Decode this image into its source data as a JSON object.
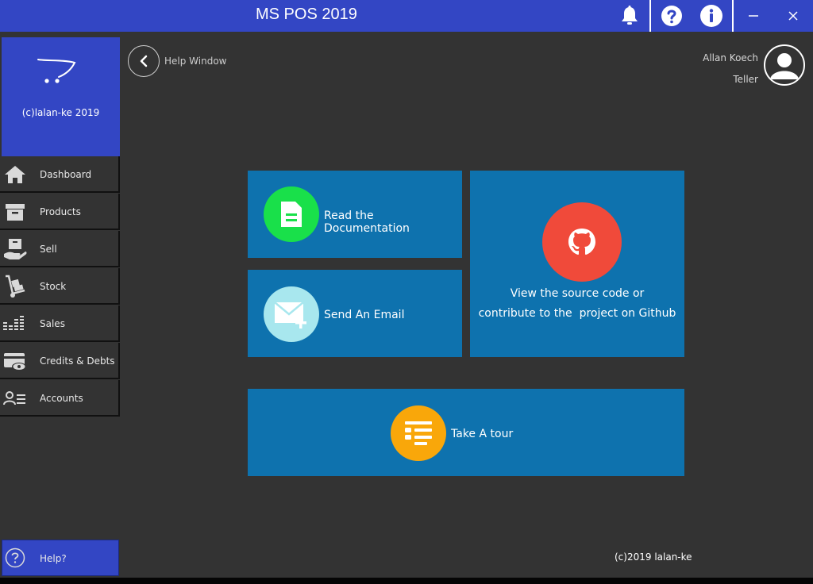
{
  "window": {
    "title": "MS POS 2019"
  },
  "colors": {
    "titlebar": "#3346c4",
    "tile": "#0e72ae",
    "docs_circle": "#19e04a",
    "email_circle": "#a8e7ee",
    "github_circle": "#f04a3a",
    "tour_circle": "#f9a70a"
  },
  "titlebar_icons": [
    "bell-icon",
    "question-circle-icon",
    "info-circle-icon",
    "minimize-icon",
    "close-icon"
  ],
  "brand": {
    "text": "(c)lalan-ke 2019"
  },
  "sidebar": {
    "items": [
      {
        "label": "Dashboard",
        "icon": "home-icon"
      },
      {
        "label": "Products",
        "icon": "archive-box-icon"
      },
      {
        "label": "Sell",
        "icon": "hand-box-icon"
      },
      {
        "label": "Stock",
        "icon": "hand-truck-icon"
      },
      {
        "label": "Sales",
        "icon": "bar-levels-icon"
      },
      {
        "label": "Credits & Debts",
        "icon": "card-eye-icon"
      },
      {
        "label": "Accounts",
        "icon": "user-list-icon"
      }
    ],
    "help_label": "Help?"
  },
  "header": {
    "page_title": "Help Window"
  },
  "user": {
    "name": "Allan Koech",
    "role": "Teller"
  },
  "tiles": {
    "docs": {
      "label": "Read the Documentation",
      "icon": "document-icon"
    },
    "email": {
      "label": "Send An Email",
      "icon": "mail-plus-icon"
    },
    "github": {
      "line1": "View the source code or",
      "line2": "contribute to the  project on Github",
      "icon": "github-icon"
    },
    "tour": {
      "label": "Take A tour",
      "icon": "list-icon"
    }
  },
  "footer": {
    "text": "(c)2019 lalan-ke"
  }
}
